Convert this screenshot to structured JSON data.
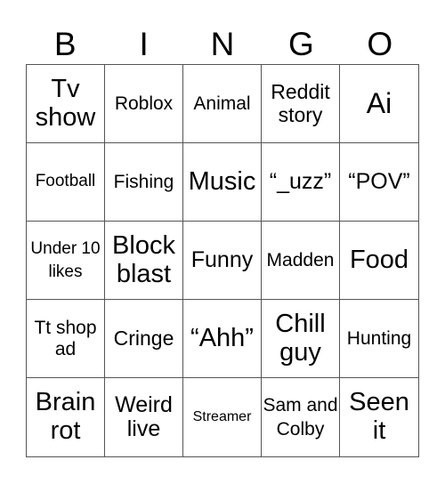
{
  "header": {
    "letters": [
      "B",
      "I",
      "N",
      "G",
      "O"
    ]
  },
  "cells": [
    "Tv show",
    "Roblox",
    "Animal",
    "Reddit story",
    "Ai",
    "Football",
    "Fishing",
    "Music",
    "“_uzz”",
    "“POV”",
    "Under 10 likes",
    "Block blast",
    "Funny",
    "Madden",
    "Food",
    "Tt shop ad",
    "Cringe",
    "“Ahh”",
    "Chill guy",
    "Hunting",
    "Brain rot",
    "Weird live",
    "Streamer",
    "Sam and Colby",
    "Seen it"
  ]
}
